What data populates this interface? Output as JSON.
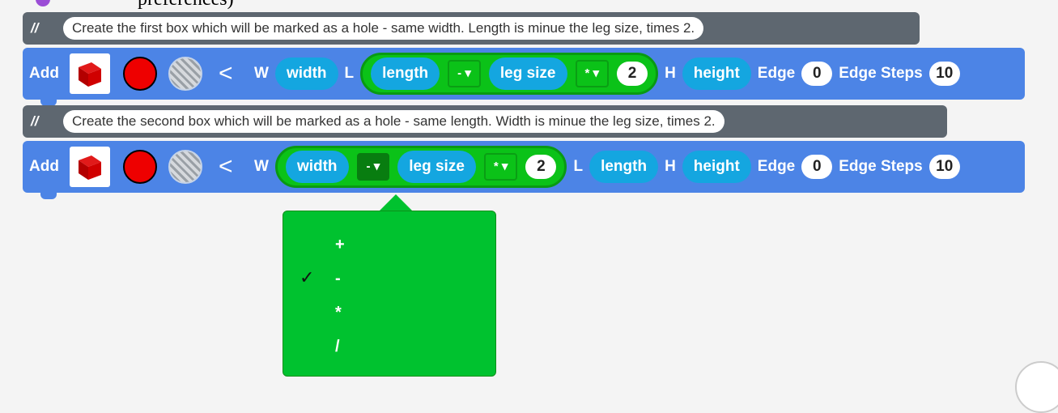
{
  "page": {
    "top_clipped_text": "preferences)"
  },
  "comments": [
    {
      "slashes": "//",
      "text": "Create the first box which will be marked as a hole - same width.  Length is minue the leg size, times 2."
    },
    {
      "slashes": "//",
      "text": "Create the second box which will be marked as a hole - same length.  Width is minue the leg size, times 2."
    }
  ],
  "blocks": [
    {
      "add": "Add",
      "color": "#ee0000",
      "chevron": "<",
      "w_label": "W",
      "width": "width",
      "l_label": "L",
      "length": "length",
      "op1": "- ▾",
      "leg_size": "leg size",
      "op2": "* ▾",
      "factor": "2",
      "h_label": "H",
      "height": "height",
      "edge_label": "Edge",
      "edge_value": "0",
      "edge_steps_label": "Edge Steps",
      "edge_steps_value": "10"
    },
    {
      "add": "Add",
      "color": "#ee0000",
      "chevron": "<",
      "w_label": "W",
      "width": "width",
      "op1": "- ▾",
      "leg_size": "leg size",
      "op2": "* ▾",
      "factor": "2",
      "l_label": "L",
      "length": "length",
      "h_label": "H",
      "height": "height",
      "edge_label": "Edge",
      "edge_value": "0",
      "edge_steps_label": "Edge Steps",
      "edge_steps_value": "10"
    }
  ],
  "operator_dropdown": {
    "selected": "-",
    "check": "✓",
    "options": [
      "+",
      "-",
      "*",
      "/"
    ]
  },
  "icons": {
    "shape": "red-cube-icon",
    "color": "color-swatch-icon",
    "texture": "texture-swatch-icon",
    "chevron": "collapse-chevron-icon"
  }
}
